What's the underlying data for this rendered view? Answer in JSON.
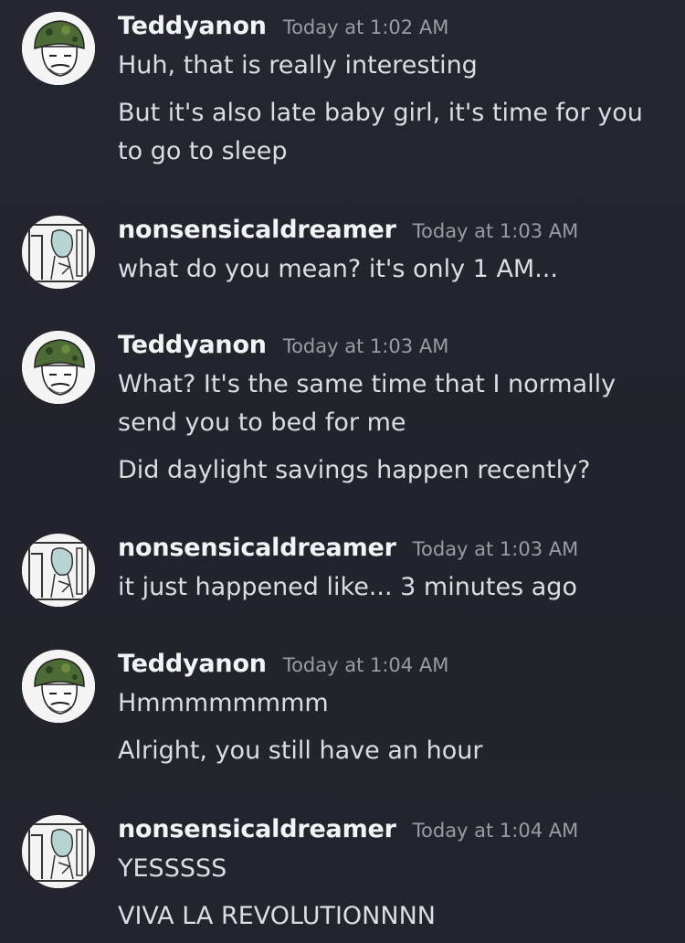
{
  "messages": [
    {
      "author": "Teddyanon",
      "timestamp": "Today at 1:02 AM",
      "lines": [
        "Huh, that is really interesting",
        "But it's also late baby girl, it's time for you",
        "to go to sleep"
      ]
    },
    {
      "author": "nonsensicaldreamer",
      "timestamp": "Today at 1:03 AM",
      "lines": [
        "what do you mean? it's only 1 AM..."
      ]
    },
    {
      "author": "Teddyanon",
      "timestamp": "Today at 1:03 AM",
      "lines": [
        "What? It's the same time that I normally",
        "send you to bed for me",
        "Did daylight savings happen recently?"
      ]
    },
    {
      "author": "nonsensicaldreamer",
      "timestamp": "Today at 1:03 AM",
      "lines": [
        "it just happened like... 3 minutes ago"
      ]
    },
    {
      "author": "Teddyanon",
      "timestamp": "Today at 1:04 AM",
      "lines": [
        "Hmmmmmmmm",
        "Alright, you still have an hour"
      ]
    },
    {
      "author": "nonsensicaldreamer",
      "timestamp": "Today at 1:04 AM",
      "lines": [
        "YESSSSS",
        "VIVA LA REVOLUTIONNNN"
      ]
    }
  ],
  "colors": {
    "background": "#23242d",
    "username": "#f2f3f5",
    "timestamp": "#9a9ca4",
    "text": "#dcdde1"
  }
}
